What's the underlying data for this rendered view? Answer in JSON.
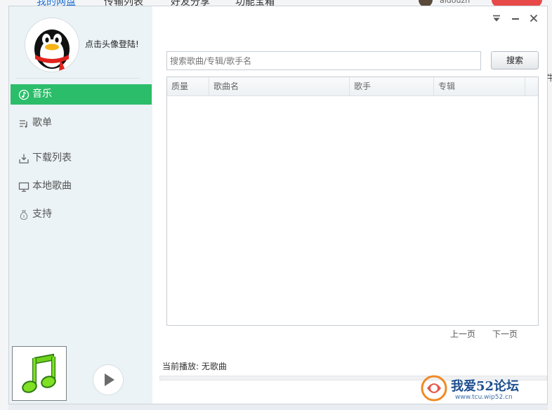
{
  "background": {
    "tabs": [
      "我的网盘",
      "传输列表",
      "好友分享",
      "功能宝箱"
    ],
    "user_name": "aidouzh",
    "right_clip_char": "牛"
  },
  "user": {
    "login_prompt": "点击头像登陆!"
  },
  "sidebar": {
    "items": [
      {
        "label": "音乐",
        "icon": "music-note-circle-icon",
        "active": true
      },
      {
        "label": "歌单",
        "icon": "playlist-icon",
        "active": false
      },
      {
        "label": "下载列表",
        "icon": "download-icon",
        "active": false
      },
      {
        "label": "本地歌曲",
        "icon": "monitor-icon",
        "active": false
      },
      {
        "label": "支持",
        "icon": "money-bag-icon",
        "active": false
      }
    ]
  },
  "search": {
    "placeholder": "搜索歌曲/专辑/歌手名",
    "button_label": "搜索"
  },
  "table": {
    "columns": [
      "质量",
      "歌曲名",
      "歌手",
      "专辑"
    ],
    "rows": []
  },
  "pager": {
    "prev_label": "上一页",
    "next_label": "下一页"
  },
  "player": {
    "now_playing_label": "当前播放: 无歌曲"
  },
  "watermark": {
    "text": "我爱52论坛",
    "url": "www.tcu.wip52.cn"
  },
  "colors": {
    "accent_green": "#2cbd6a",
    "sidebar_bg": "#ebf3f6"
  }
}
